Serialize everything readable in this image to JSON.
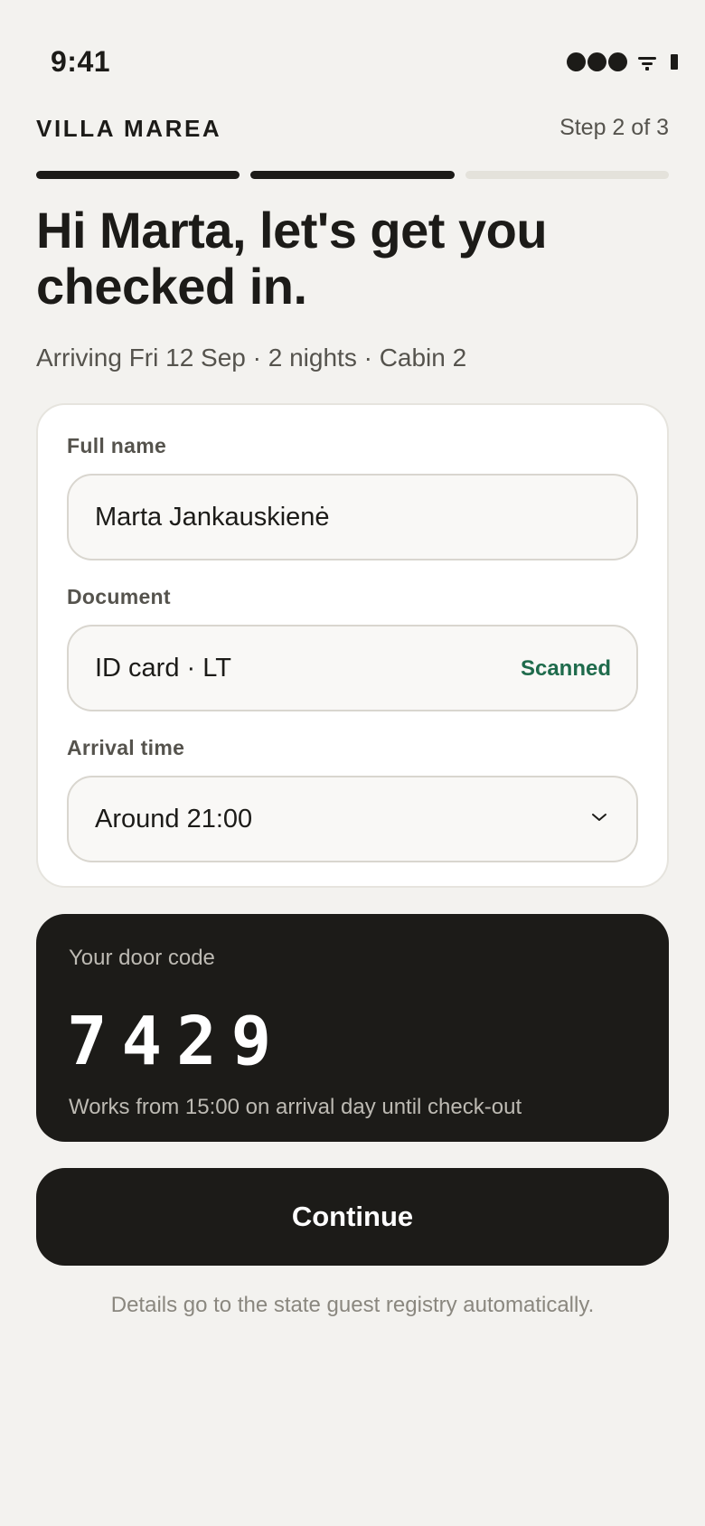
{
  "status_bar": {
    "time": "9:41",
    "icons": [
      "signal-icon",
      "wifi-icon",
      "battery-icon"
    ]
  },
  "header": {
    "brand": "VILLA MAREA",
    "step": "Step 2 of 3"
  },
  "progress": {
    "current_step": 2,
    "total_steps": 3
  },
  "main": {
    "headline": "Hi Marta, let's get you checked in.",
    "subline": "Arriving Fri 12 Sep · 2 nights · Cabin 2"
  },
  "form": {
    "full_name": {
      "label": "Full name",
      "value": "Marta Jankauskienė"
    },
    "document": {
      "label": "Document",
      "value": "ID card · LT",
      "status": "Scanned"
    },
    "arrival_time": {
      "label": "Arrival time",
      "value": "Around 21:00",
      "icon": "chevron-down-icon"
    }
  },
  "door_code": {
    "label": "Your door code",
    "code": "7429",
    "note": "Works from 15:00 on arrival day until check-out"
  },
  "actions": {
    "continue_label": "Continue"
  },
  "footer": {
    "note": "Details go to the state guest registry automatically."
  },
  "colors": {
    "background": "#f3f2ef",
    "ink": "#1c1b18",
    "muted": "#55534d",
    "success": "#1f6b4c",
    "progress_track": "#e4e2db"
  }
}
